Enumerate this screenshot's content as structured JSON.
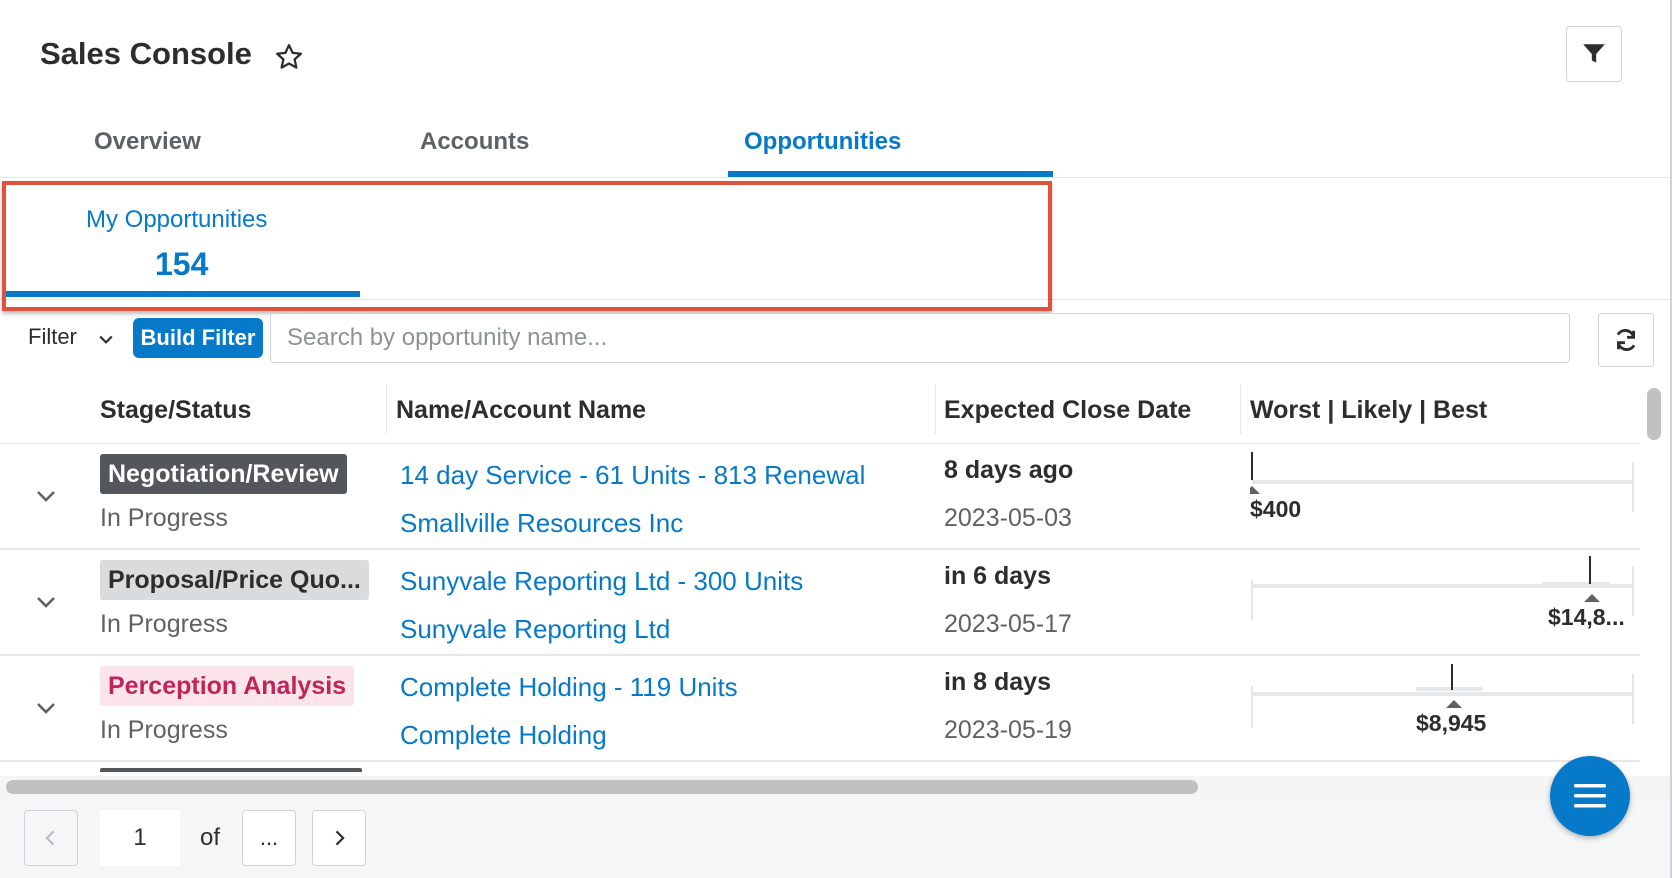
{
  "header": {
    "title": "Sales Console"
  },
  "tabs": [
    {
      "label": "Overview",
      "active": false
    },
    {
      "label": "Accounts",
      "active": false
    },
    {
      "label": "Opportunities",
      "active": true
    }
  ],
  "list_view": {
    "name": "My Opportunities",
    "count": "154"
  },
  "filter_bar": {
    "filter_label": "Filter",
    "build_filter_label": "Build Filter",
    "search_placeholder": "Search by opportunity name..."
  },
  "table": {
    "columns": [
      "Stage/Status",
      "Name/Account Name",
      "Expected Close Date",
      "Worst | Likely | Best"
    ],
    "rows": [
      {
        "stage": "Negotiation/Review",
        "stage_style": "dark",
        "status": "In Progress",
        "name": "14 day Service - 61 Units - 813 Renewal",
        "account": "Smallville Resources Inc",
        "relative_date": "8 days ago",
        "close_date": "2023-05-03",
        "likely_amount": "$400"
      },
      {
        "stage": "Proposal/Price Quo...",
        "stage_style": "gray",
        "status": "In Progress",
        "name": "Sunyvale Reporting Ltd - 300 Units",
        "account": "Sunyvale Reporting Ltd",
        "relative_date": "in 6 days",
        "close_date": "2023-05-17",
        "likely_amount": "$14,8..."
      },
      {
        "stage": "Perception Analysis",
        "stage_style": "pink",
        "status": "In Progress",
        "name": "Complete Holding - 119 Units",
        "account": "Complete Holding",
        "relative_date": "in 8 days",
        "close_date": "2023-05-19",
        "likely_amount": "$8,945"
      }
    ]
  },
  "pagination": {
    "current_page": "1",
    "of_label": "of",
    "total_label": "..."
  },
  "colors": {
    "accent": "#0679c8",
    "highlight": "#e1523d",
    "stage_dark_bg": "#53575b",
    "stage_gray_bg": "#d9dbdd",
    "stage_pink_bg": "#fde4ea",
    "stage_pink_text": "#c0245a"
  },
  "icons": {
    "favorite": "star-outline-icon",
    "filter": "funnel-icon",
    "refresh": "refresh-icon",
    "expand": "chevron-down-icon",
    "prev": "chevron-left-icon",
    "next": "chevron-right-icon",
    "menu": "hamburger-menu-icon"
  }
}
